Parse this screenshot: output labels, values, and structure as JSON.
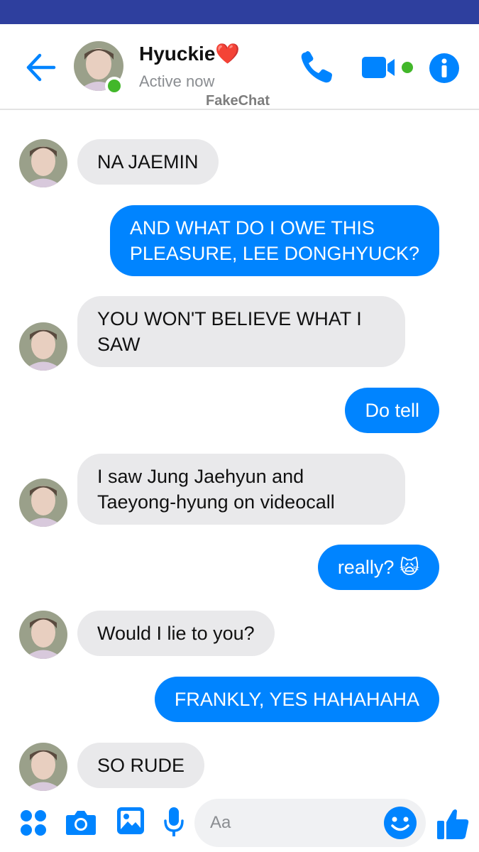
{
  "header": {
    "contact_name": "Hyuckie❤️",
    "status": "Active now",
    "watermark": "FakeChat"
  },
  "composer": {
    "placeholder": "Aa"
  },
  "colors": {
    "accent": "#0084ff",
    "incoming_bubble": "#e9e9eb",
    "online": "#42b72a",
    "status_bar": "#2e3f9e"
  },
  "messages": [
    {
      "from": "them",
      "text": "NA JAEMIN"
    },
    {
      "from": "me",
      "text": "AND WHAT DO I OWE THIS\nPLEASURE, LEE DONGHYUCK?"
    },
    {
      "from": "them",
      "text": "YOU WON'T BELIEVE WHAT I\nSAW"
    },
    {
      "from": "me",
      "text": "Do tell"
    },
    {
      "from": "them",
      "text": "I saw Jung Jaehyun and\nTaeyong-hyung on videocall"
    },
    {
      "from": "me",
      "text": "really? 🙀"
    },
    {
      "from": "them",
      "text": "Would I lie to you?"
    },
    {
      "from": "me",
      "text": "FRANKLY, YES HAHAHAHA"
    },
    {
      "from": "them",
      "text": "SO RUDE"
    }
  ]
}
